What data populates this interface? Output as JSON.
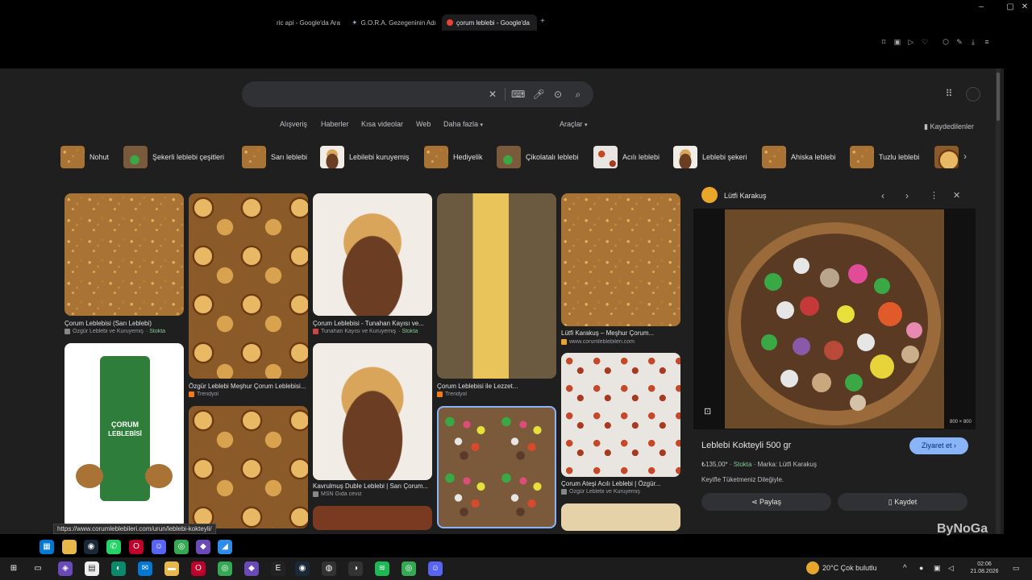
{
  "browser": {
    "tabs": [
      {
        "label": "ric api - Google'da Ara",
        "active": false
      },
      {
        "label": "G.O.R.A. Gezegeninin Adı",
        "active": false
      },
      {
        "label": "çorum leblebi - Google'da",
        "active": true
      }
    ],
    "new_tab_label": "+",
    "status_url": "https://www.corumleblebileri.com/urun/leblebi-kokteyli/"
  },
  "search": {
    "nav_links": [
      "Alışveriş",
      "Haberler",
      "Kısa videolar",
      "Web",
      "Daha fazla"
    ],
    "tools_label": "Araçlar",
    "saved_label": "Kaydedilenler",
    "chips": [
      "Nohut",
      "Şekerli leblebi çeşitleri",
      "Sarı leblebi",
      "Lebilebi kuruyemiş",
      "Hediyelik",
      "Çikolatalı leblebi",
      "Acılı leblebi",
      "Leblebi şekeri",
      "Ahiska leblebi",
      "Tuzlu leblebi"
    ]
  },
  "results": {
    "col1": [
      {
        "caption": "Çorum Leblebisi (Sarı Leblebi)",
        "source": "Özgür Leblebi ve Kuruyemiş",
        "stock": "· Stokta"
      }
    ],
    "col2": [
      {
        "caption": "Özgür Leblebi Meşhur Çorum Leblebisi...",
        "source": "Trendyol",
        "stock": ""
      }
    ],
    "col3": [
      {
        "caption": "Çorum Leblebisi - Tunahan Kayısı ve...",
        "source": "Tunahan Kayısı ve Kuruyemiş",
        "stock": "· Stokta"
      },
      {
        "caption": "Kavrulmuş Duble Leblebi | Sarı Çorum...",
        "source": "MSN Gıda ceviz",
        "stock": ""
      }
    ],
    "col4": [
      {
        "caption": "Çorum Leblebisi ile Lezzet...",
        "source": "Trendyol",
        "stock": ""
      }
    ],
    "col5": [
      {
        "caption": "Lütfi Karakuş – Meşhur Çorum...",
        "source": "www.corumleblebileri.com",
        "stock": ""
      },
      {
        "caption": "Çorum Ateşi Acılı Leblebi | Özgür...",
        "source": "Özgür Leblebi ve Kuruyemiş",
        "stock": ""
      }
    ],
    "pack_label_top": "ÇORUM",
    "pack_label_bottom": "LEBLEBİSİ"
  },
  "panel": {
    "source_name": "Lütfi Karakuş",
    "image_size": "800 × 800",
    "title": "Leblebi Kokteyli 500 gr",
    "visit_label": "Ziyaret et",
    "price": "₺135,00*",
    "stock": "· Stokta",
    "brand": "· Marka: Lütfi Karakuş",
    "description": "Keyifle Tüketmeniz Dileğiyle.",
    "share_label": "Paylaş",
    "save_label": "Kaydet"
  },
  "taskbar": {
    "weather": "20°C  Çok bulutlu",
    "time": "02:06",
    "date": "21.08.2026",
    "watermark": "ByNoGa"
  }
}
